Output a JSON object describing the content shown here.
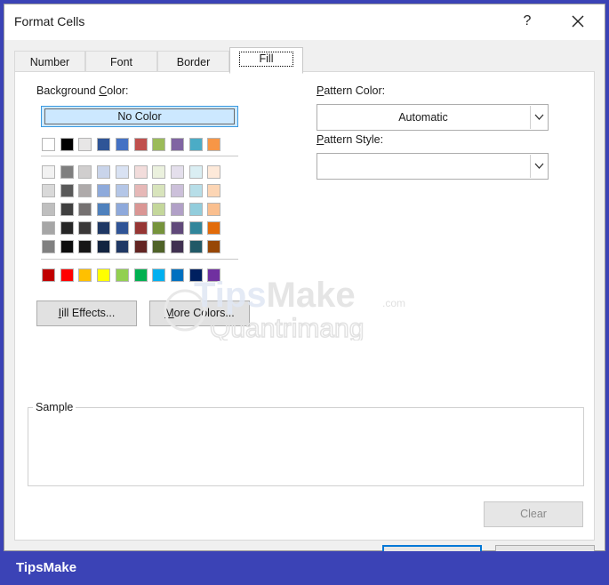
{
  "window": {
    "title": "Format Cells",
    "help_label": "?",
    "close_icon": "close-icon"
  },
  "tabs": [
    {
      "label": "Number",
      "active": false
    },
    {
      "label": "Font",
      "active": false
    },
    {
      "label": "Border",
      "active": false
    },
    {
      "label": "Fill",
      "active": true
    }
  ],
  "fill": {
    "background_color": {
      "label_prefix": "Background ",
      "label_accel": "C",
      "label_suffix": "olor:",
      "no_color_label": "No Color",
      "theme_row": [
        "#ffffff",
        "#000000",
        "#e7e6e6",
        "#2f5597",
        "#4472c4",
        "#c0504d",
        "#9bbb59",
        "#8064a2",
        "#4bacc6",
        "#f79646"
      ],
      "shade_rows": [
        [
          "#f2f2f2",
          "#7f7f7f",
          "#d0cece",
          "#c9d4ea",
          "#d9e2f3",
          "#f2dcdb",
          "#ebf1de",
          "#e4dfec",
          "#daeef3",
          "#fde9d9"
        ],
        [
          "#d9d9d9",
          "#595959",
          "#aeaaaa",
          "#8eaadb",
          "#b4c6e7",
          "#e6b8b7",
          "#d8e4bc",
          "#ccc0da",
          "#b7dee8",
          "#fcd5b4"
        ],
        [
          "#bfbfbf",
          "#404040",
          "#757171",
          "#4f81bd",
          "#8ea9db",
          "#da9694",
          "#c4d79b",
          "#b1a0c7",
          "#92cddc",
          "#fabf8f"
        ],
        [
          "#a6a6a6",
          "#262626",
          "#3a3838",
          "#1f3864",
          "#305496",
          "#963634",
          "#76933c",
          "#60497a",
          "#31869b",
          "#e26b0a"
        ],
        [
          "#808080",
          "#0d0d0d",
          "#171616",
          "#132440",
          "#203864",
          "#632523",
          "#4f6228",
          "#403151",
          "#215967",
          "#974706"
        ]
      ],
      "standard_row": [
        "#c00000",
        "#ff0000",
        "#ffc000",
        "#ffff00",
        "#92d050",
        "#00b050",
        "#00b0f0",
        "#0070c0",
        "#002060",
        "#7030a0"
      ]
    },
    "fill_effects_prefix": "",
    "fill_effects_accel": "I",
    "fill_effects_suffix": "ill Effects...",
    "more_colors_prefix": "",
    "more_colors_accel": "M",
    "more_colors_suffix": "ore Colors...",
    "pattern_color": {
      "label_prefix": "",
      "label_accel": "P",
      "label_suffix": "attern Color:",
      "value": "Automatic"
    },
    "pattern_style": {
      "label_prefix": "",
      "label_accel": "P",
      "label_suffix": "attern Style:",
      "value": ""
    },
    "sample_label": "Sample",
    "clear_label": "Clear"
  },
  "watermark": {
    "brand_prefix": "Tips",
    "brand_suffix": "Make",
    "domain_suffix": ".com",
    "subtext": "Quantrimang"
  },
  "footer": {
    "brand": "TipsMake"
  }
}
